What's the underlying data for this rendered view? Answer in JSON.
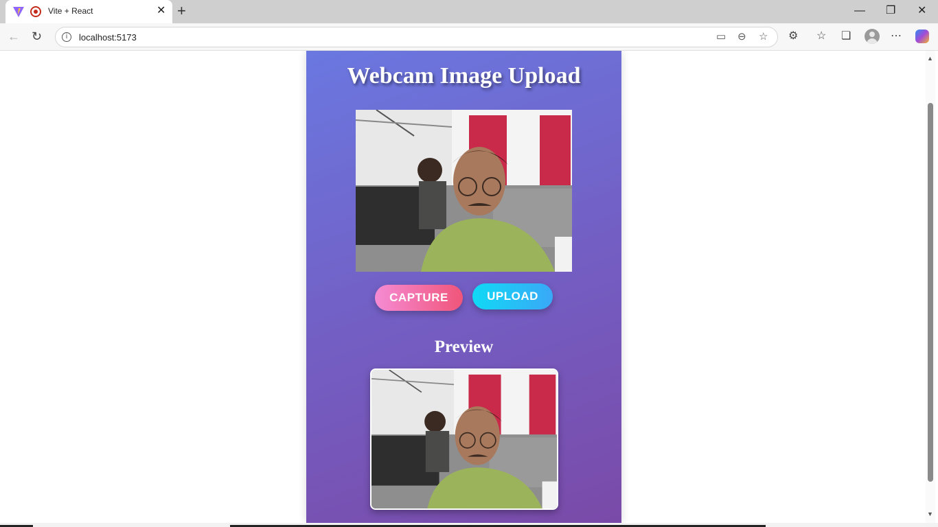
{
  "browser": {
    "tab_title": "Vite + React",
    "url": "localhost:5173"
  },
  "app": {
    "title": "Webcam Image Upload",
    "capture_label": "CAPTURE",
    "upload_label": "UPLOAD",
    "preview_heading": "Preview"
  },
  "colors": {
    "panel_gradient_start": "#6a78e0",
    "panel_gradient_end": "#7a4aa8",
    "capture_gradient": [
      "#f58bd4",
      "#f0557a"
    ],
    "upload_gradient": [
      "#10d9f5",
      "#3aa8f7"
    ]
  },
  "icons": [
    "vite-logo-icon",
    "recording-icon",
    "close-icon",
    "new-tab-icon",
    "minimize-icon",
    "maximize-icon",
    "window-close-icon",
    "back-icon",
    "reload-icon",
    "site-info-icon",
    "camera-icon",
    "zoom-out-icon",
    "star-icon",
    "extensions-icon",
    "favorites-icon",
    "collections-icon",
    "profile-icon",
    "more-icon",
    "copilot-icon"
  ]
}
